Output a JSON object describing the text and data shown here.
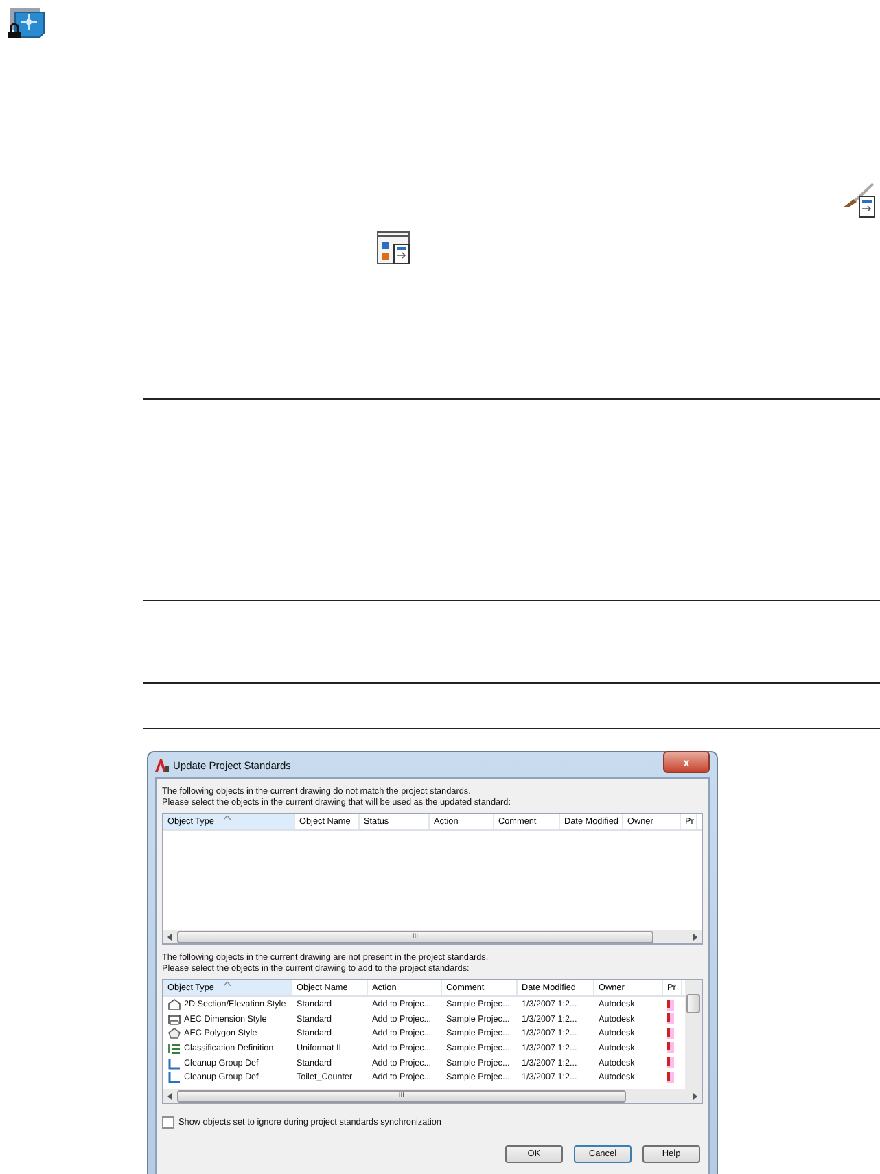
{
  "dialog": {
    "title": "Update Project Standards",
    "close": "x",
    "section_1": {
      "lines": [
        "The following objects in the current drawing do not match the project standards.",
        "Please select the objects in the current drawing that will be used as the updated standard:"
      ],
      "columns": [
        "Object Type",
        "Object Name",
        "Status",
        "Action",
        "Comment",
        "Date Modified",
        "Owner",
        "Pr"
      ],
      "scroll": "III"
    },
    "section_2": {
      "lines": [
        "The following objects in the current drawing are not present in the project standards.",
        "Please select the objects in the current drawing to add to the project standards:"
      ],
      "columns": [
        "Object Type",
        "Object Name",
        "Action",
        "Comment",
        "Date Modified",
        "Owner",
        "Pr"
      ],
      "scroll": "III",
      "rows": [
        [
          "2D Section/Elevation Style",
          "Standard",
          "Add to Projec...",
          "Sample Projec...",
          "1/3/2007 1:2...",
          "Autodesk"
        ],
        [
          "AEC Dimension Style",
          "Standard",
          "Add to Projec...",
          "Sample Projec...",
          "1/3/2007 1:2...",
          "Autodesk"
        ],
        [
          "AEC Polygon Style",
          "Standard",
          "Add to Projec...",
          "Sample Projec...",
          "1/3/2007 1:2...",
          "Autodesk"
        ],
        [
          "Classification Definition",
          "Uniformat II",
          "Add to Projec...",
          "Sample Projec...",
          "1/3/2007 1:2...",
          "Autodesk"
        ],
        [
          "Cleanup Group Def",
          "Standard",
          "Add to Projec...",
          "Sample Projec...",
          "1/3/2007 1:2...",
          "Autodesk"
        ],
        [
          "Cleanup Group Def",
          "Toilet_Counter",
          "Add to Projec...",
          "Sample Projec...",
          "1/3/2007 1:2...",
          "Autodesk"
        ]
      ]
    },
    "checkbox": {
      "label": "Show objects set to ignore during project standards synchronization",
      "checked": false
    },
    "buttons": [
      {
        "label": "OK",
        "selected": false
      },
      {
        "label": "Cancel",
        "selected": true
      },
      {
        "label": "Help",
        "selected": false
      }
    ]
  }
}
